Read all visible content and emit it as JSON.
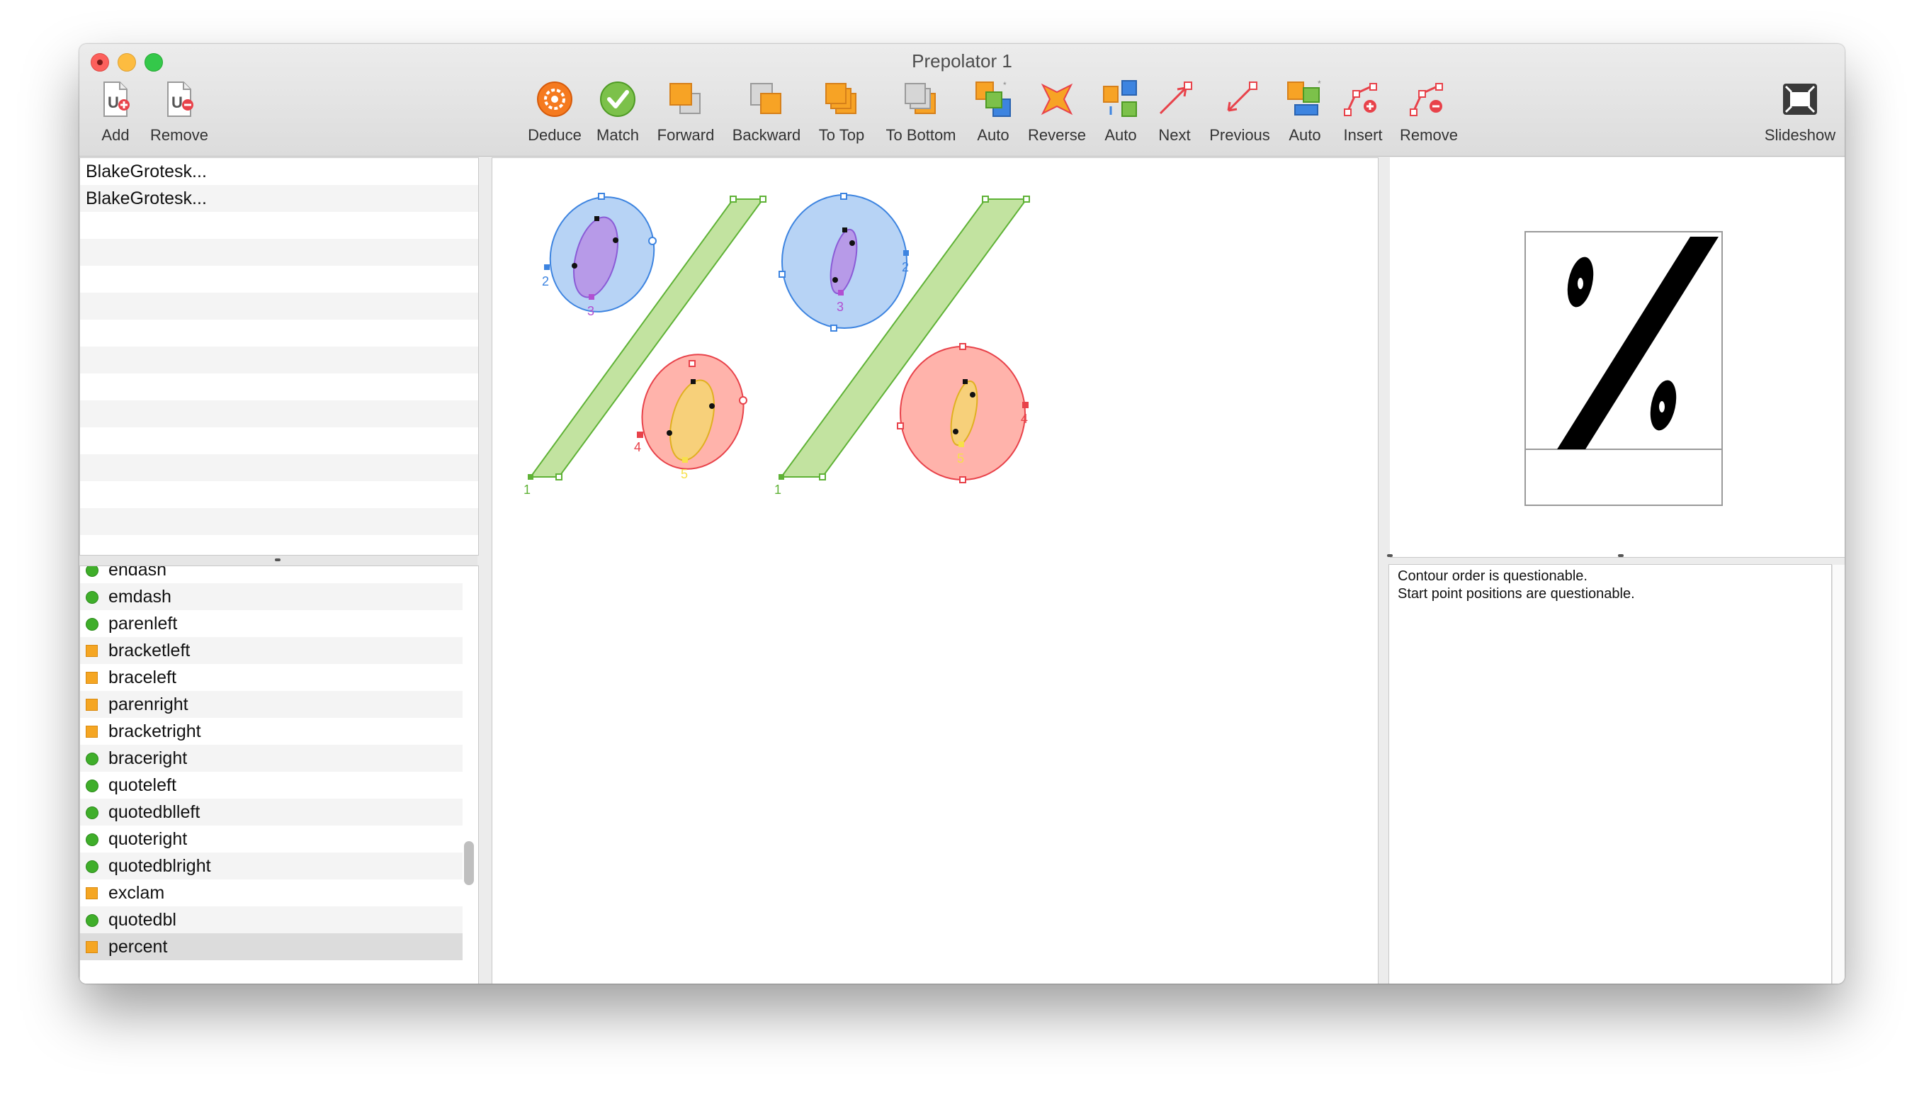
{
  "window": {
    "title": "Prepolator 1"
  },
  "toolbar": {
    "add": "Add",
    "remove_font": "Remove",
    "deduce": "Deduce",
    "match": "Match",
    "forward": "Forward",
    "backward": "Backward",
    "to_top": "To Top",
    "to_bottom": "To Bottom",
    "auto_order": "Auto",
    "reverse": "Reverse",
    "auto_direction": "Auto",
    "next": "Next",
    "previous": "Previous",
    "auto_start": "Auto",
    "insert": "Insert",
    "remove_point": "Remove",
    "slideshow": "Slideshow"
  },
  "fonts": [
    {
      "name": "BlakeGrotesk..."
    },
    {
      "name": "BlakeGrotesk..."
    }
  ],
  "glyphs": [
    {
      "name": "endash",
      "status": "ok"
    },
    {
      "name": "emdash",
      "status": "ok"
    },
    {
      "name": "parenleft",
      "status": "ok"
    },
    {
      "name": "bracketleft",
      "status": "warn"
    },
    {
      "name": "braceleft",
      "status": "warn"
    },
    {
      "name": "parenright",
      "status": "warn"
    },
    {
      "name": "bracketright",
      "status": "warn"
    },
    {
      "name": "braceright",
      "status": "ok"
    },
    {
      "name": "quoteleft",
      "status": "ok"
    },
    {
      "name": "quotedblleft",
      "status": "ok"
    },
    {
      "name": "quoteright",
      "status": "ok"
    },
    {
      "name": "quotedblright",
      "status": "ok"
    },
    {
      "name": "exclam",
      "status": "warn"
    },
    {
      "name": "quotedbl",
      "status": "ok"
    },
    {
      "name": "percent",
      "status": "warn",
      "selected": true
    }
  ],
  "canvas": {
    "contour_labels": [
      "1",
      "2",
      "3",
      "4",
      "5"
    ]
  },
  "report": {
    "lines": [
      "Contour order is questionable.",
      "Start point positions are questionable."
    ]
  },
  "colors": {
    "contour_slash": "#c2e3a0",
    "contour_top_outer": "#b7d3f5",
    "contour_top_inner": "#b79ae8",
    "contour_bottom_outer": "#ffb3ab",
    "contour_bottom_inner": "#f7d07a",
    "status_ok": "#3fae2a",
    "status_warn": "#f5a623"
  }
}
